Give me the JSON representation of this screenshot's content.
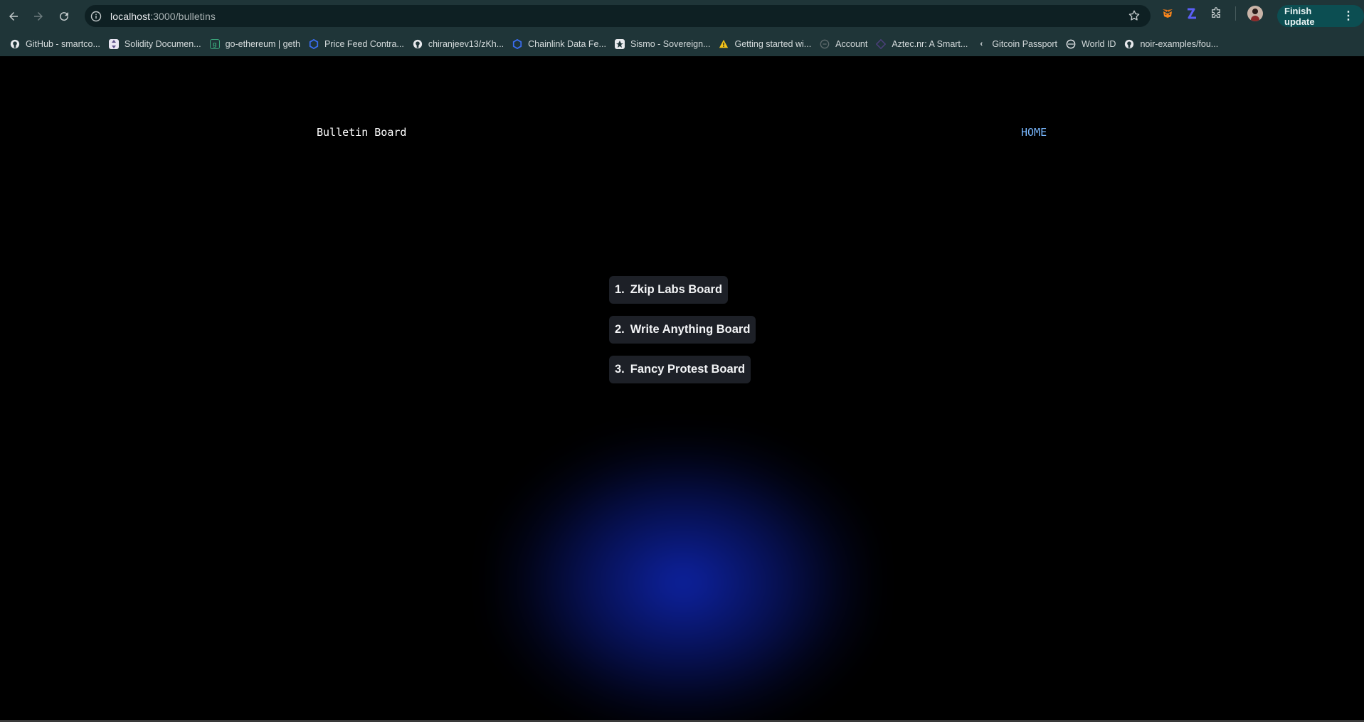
{
  "browser": {
    "url_host": "localhost",
    "url_path": ":3000/bulletins",
    "finish_update_label": "Finish update",
    "bookmarks": [
      {
        "label": "GitHub - smartco...",
        "icon": "github-icon"
      },
      {
        "label": "Solidity Documen...",
        "icon": "solidity-icon"
      },
      {
        "label": "go-ethereum | geth",
        "icon": "geth-icon"
      },
      {
        "label": "Price Feed Contra...",
        "icon": "chainlink-icon"
      },
      {
        "label": "chiranjeev13/zKh...",
        "icon": "github-icon"
      },
      {
        "label": "Chainlink Data Fe...",
        "icon": "chainlink-icon"
      },
      {
        "label": "Sismo - Sovereign...",
        "icon": "sismo-icon"
      },
      {
        "label": "Getting started wi...",
        "icon": "warning-icon"
      },
      {
        "label": "Account",
        "icon": "account-icon"
      },
      {
        "label": "Aztec.nr: A Smart...",
        "icon": "aztec-icon"
      },
      {
        "label": "Gitcoin Passport",
        "icon": "gitcoin-icon"
      },
      {
        "label": "World ID",
        "icon": "worldid-icon"
      },
      {
        "label": "noir-examples/fou...",
        "icon": "github-icon"
      }
    ]
  },
  "header": {
    "title": "Bulletin Board",
    "home_link": "HOME"
  },
  "boards": [
    {
      "number": "1.",
      "name": "Zkip Labs Board"
    },
    {
      "number": "2.",
      "name": "Write Anything Board"
    },
    {
      "number": "3.",
      "name": "Fancy Protest Board"
    }
  ],
  "colors": {
    "chrome_bg": "#1f3538",
    "page_bg": "#000000",
    "home_link": "#79b8ff",
    "board_bg": "#1d2027",
    "glow": "#1028be"
  }
}
